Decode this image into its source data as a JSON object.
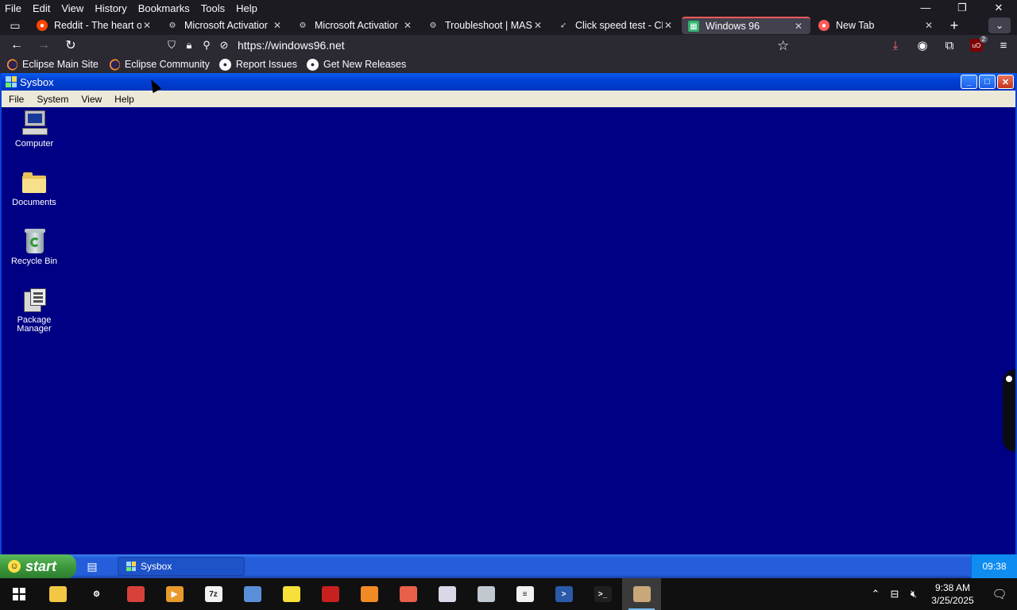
{
  "browser": {
    "menu": [
      "File",
      "Edit",
      "View",
      "History",
      "Bookmarks",
      "Tools",
      "Help"
    ],
    "tabs": [
      {
        "label": "Reddit - The heart o",
        "icon": "reddit-icon",
        "color": "#ff4500"
      },
      {
        "label": "Microsoft Activatior",
        "icon": "gear-icon",
        "color": "#cfcfd8"
      },
      {
        "label": "Microsoft Activatior",
        "icon": "gear-icon",
        "color": "#cfcfd8"
      },
      {
        "label": "Troubleshoot | MAS",
        "icon": "gear-icon",
        "color": "#cfcfd8"
      },
      {
        "label": "Click speed test - CF",
        "icon": "cursor-click-icon",
        "color": "#cfcfd8"
      },
      {
        "label": "Windows 96",
        "icon": "windows96-icon",
        "color": "#2fb36f",
        "active": true
      },
      {
        "label": "New Tab",
        "icon": "firefox-icon",
        "color": "#ff5a5a"
      }
    ],
    "url": "https://windows96.net",
    "bookmarks": [
      "Eclipse Main Site",
      "Eclipse Community",
      "Report Issues",
      "Get New Releases"
    ],
    "ublock_badge": "2"
  },
  "sysbox": {
    "title": "Sysbox",
    "menu": [
      "File",
      "System",
      "View",
      "Help"
    ],
    "desktop_icons": [
      {
        "label": "Computer",
        "icon": "computer-icon"
      },
      {
        "label": "Documents",
        "icon": "folder-icon"
      },
      {
        "label": "Recycle Bin",
        "icon": "recycle-bin-icon"
      },
      {
        "label": "Package Manager",
        "icon": "package-manager-icon"
      }
    ]
  },
  "w96_taskbar": {
    "start_label": "start",
    "task_label": "Sysbox",
    "time": "09:38"
  },
  "windows_taskbar": {
    "time": "9:38 AM",
    "date": "3/25/2025",
    "apps": [
      {
        "icon": "file-explorer-icon",
        "color": "#f2c744",
        "text": ""
      },
      {
        "icon": "settings-icon",
        "color": "#101010",
        "text": "⚙"
      },
      {
        "icon": "cyberfox-icon",
        "color": "#d8413a",
        "text": ""
      },
      {
        "icon": "media-player-icon",
        "color": "#e89a2c",
        "text": "▶"
      },
      {
        "icon": "7zip-icon",
        "color": "#f2f2f2",
        "text": "7z"
      },
      {
        "icon": "calculator-icon",
        "color": "#5a8ed8",
        "text": ""
      },
      {
        "icon": "spongebob-icon",
        "color": "#f7e03a",
        "text": ""
      },
      {
        "icon": "red-app-icon",
        "color": "#c8201e",
        "text": ""
      },
      {
        "icon": "orange-app-icon",
        "color": "#f08a24",
        "text": ""
      },
      {
        "icon": "shrimp-app-icon",
        "color": "#e8604a",
        "text": ""
      },
      {
        "icon": "satellite-app-icon",
        "color": "#d8d8e8",
        "text": ""
      },
      {
        "icon": "scanner-app-icon",
        "color": "#c0c8d0",
        "text": ""
      },
      {
        "icon": "list-app-icon",
        "color": "#f2f2f2",
        "text": "≡"
      },
      {
        "icon": "powershell-icon",
        "color": "#2a5aa8",
        "text": ">"
      },
      {
        "icon": "terminal-icon",
        "color": "#202020",
        "text": ">_"
      },
      {
        "icon": "camera-app-icon",
        "color": "#c8a878",
        "text": ""
      },
      {
        "icon": "crab-app-icon",
        "color": "#101010",
        "text": ""
      }
    ],
    "active_index": 15
  }
}
